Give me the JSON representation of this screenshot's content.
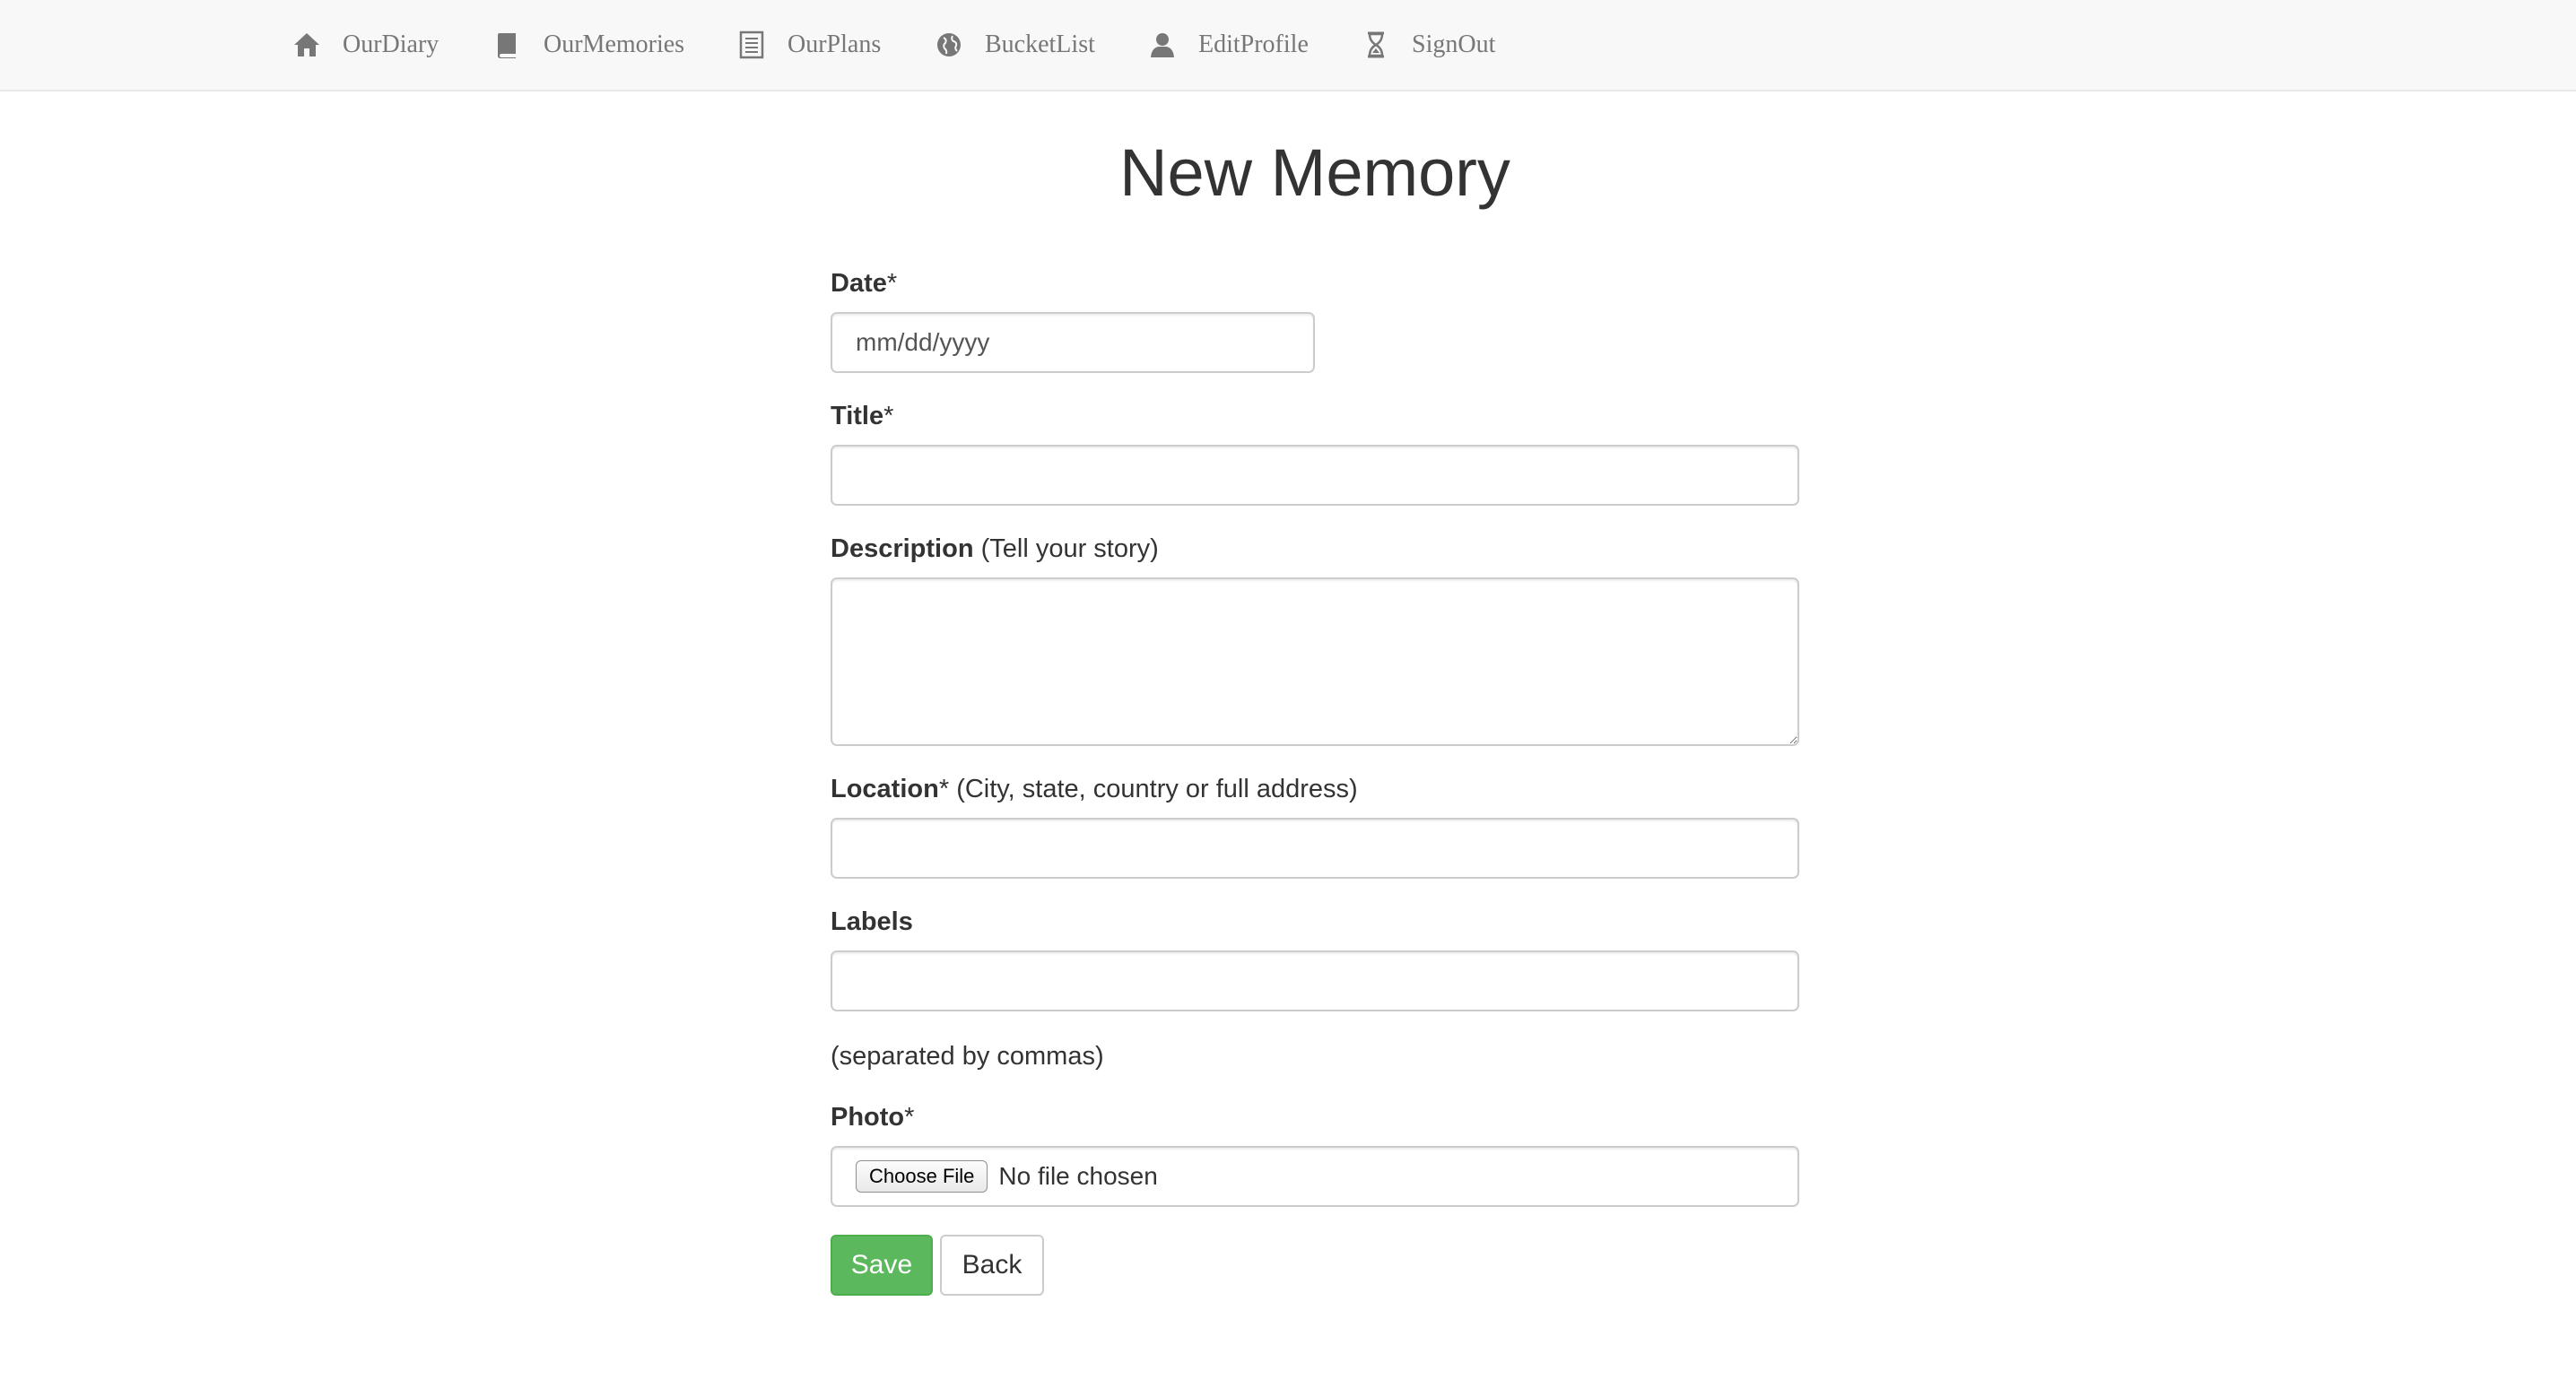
{
  "nav": {
    "items": [
      {
        "label": "OurDiary",
        "icon": "home-icon"
      },
      {
        "label": "OurMemories",
        "icon": "book-icon"
      },
      {
        "label": "OurPlans",
        "icon": "list-icon"
      },
      {
        "label": "BucketList",
        "icon": "globe-icon"
      },
      {
        "label": "EditProfile",
        "icon": "user-icon"
      },
      {
        "label": "SignOut",
        "icon": "hourglass-icon"
      }
    ]
  },
  "page": {
    "title": "New Memory"
  },
  "form": {
    "date": {
      "label": "Date",
      "required_mark": "*",
      "placeholder": "mm/dd/yyyy",
      "value": ""
    },
    "title": {
      "label": "Title",
      "required_mark": "*",
      "value": ""
    },
    "description": {
      "label": "Description",
      "hint": " (Tell your story)",
      "value": ""
    },
    "location": {
      "label": "Location",
      "required_mark": "*",
      "hint": " (City, state, country or full address)",
      "value": ""
    },
    "labels": {
      "label": "Labels",
      "value": "",
      "help": "(separated by commas)"
    },
    "photo": {
      "label": "Photo",
      "required_mark": "*",
      "button": "Choose File",
      "status": "No file chosen"
    }
  },
  "actions": {
    "save": "Save",
    "back": "Back"
  },
  "colors": {
    "save_bg": "#5cb85c",
    "navbar_bg": "#f8f8f8",
    "nav_text": "#777777"
  }
}
